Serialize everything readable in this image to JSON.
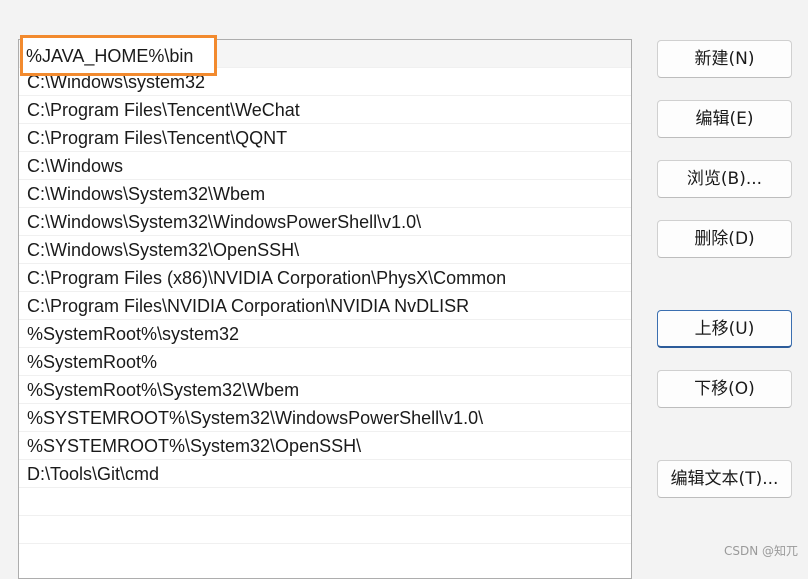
{
  "path_editor": {
    "editing_value": "%JAVA_HOME%\\bin",
    "entries": [
      "C:\\Windows\\system32",
      "C:\\Program Files\\Tencent\\WeChat",
      "C:\\Program Files\\Tencent\\QQNT",
      "C:\\Windows",
      "C:\\Windows\\System32\\Wbem",
      "C:\\Windows\\System32\\WindowsPowerShell\\v1.0\\",
      "C:\\Windows\\System32\\OpenSSH\\",
      "C:\\Program Files (x86)\\NVIDIA Corporation\\PhysX\\Common",
      "C:\\Program Files\\NVIDIA Corporation\\NVIDIA NvDLISR",
      "%SystemRoot%\\system32",
      "%SystemRoot%",
      "%SystemRoot%\\System32\\Wbem",
      "%SYSTEMROOT%\\System32\\WindowsPowerShell\\v1.0\\",
      "%SYSTEMROOT%\\System32\\OpenSSH\\",
      "D:\\Tools\\Git\\cmd"
    ]
  },
  "buttons": {
    "new": "新建(N)",
    "edit": "编辑(E)",
    "browse": "浏览(B)...",
    "delete": "删除(D)",
    "move_up": "上移(U)",
    "move_down": "下移(O)",
    "edit_text": "编辑文本(T)..."
  },
  "watermark": "CSDN @知兀",
  "colors": {
    "highlight_border": "#f28a2e",
    "focus_border": "#3b6fb0"
  }
}
